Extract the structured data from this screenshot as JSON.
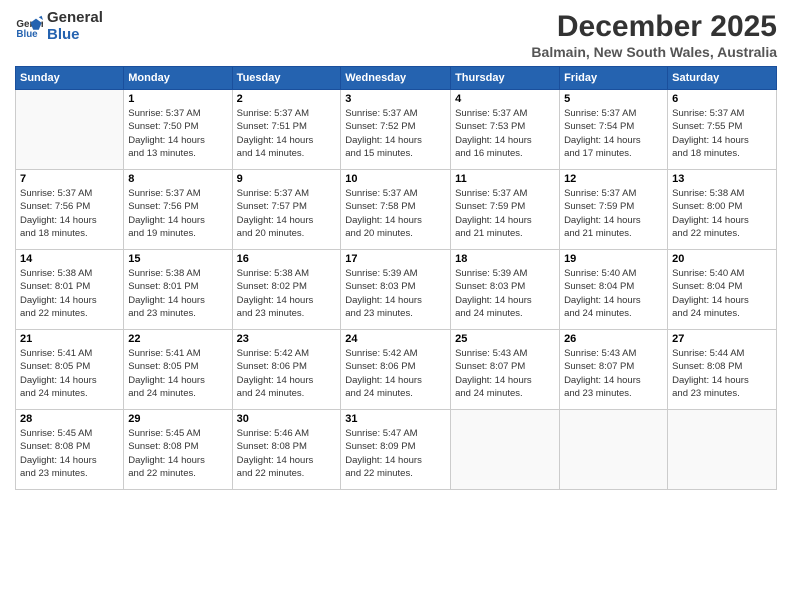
{
  "logo": {
    "line1": "General",
    "line2": "Blue"
  },
  "title": "December 2025",
  "subtitle": "Balmain, New South Wales, Australia",
  "days_header": [
    "Sunday",
    "Monday",
    "Tuesday",
    "Wednesday",
    "Thursday",
    "Friday",
    "Saturday"
  ],
  "weeks": [
    [
      {
        "num": "",
        "info": ""
      },
      {
        "num": "1",
        "info": "Sunrise: 5:37 AM\nSunset: 7:50 PM\nDaylight: 14 hours\nand 13 minutes."
      },
      {
        "num": "2",
        "info": "Sunrise: 5:37 AM\nSunset: 7:51 PM\nDaylight: 14 hours\nand 14 minutes."
      },
      {
        "num": "3",
        "info": "Sunrise: 5:37 AM\nSunset: 7:52 PM\nDaylight: 14 hours\nand 15 minutes."
      },
      {
        "num": "4",
        "info": "Sunrise: 5:37 AM\nSunset: 7:53 PM\nDaylight: 14 hours\nand 16 minutes."
      },
      {
        "num": "5",
        "info": "Sunrise: 5:37 AM\nSunset: 7:54 PM\nDaylight: 14 hours\nand 17 minutes."
      },
      {
        "num": "6",
        "info": "Sunrise: 5:37 AM\nSunset: 7:55 PM\nDaylight: 14 hours\nand 18 minutes."
      }
    ],
    [
      {
        "num": "7",
        "info": "Sunrise: 5:37 AM\nSunset: 7:56 PM\nDaylight: 14 hours\nand 18 minutes."
      },
      {
        "num": "8",
        "info": "Sunrise: 5:37 AM\nSunset: 7:56 PM\nDaylight: 14 hours\nand 19 minutes."
      },
      {
        "num": "9",
        "info": "Sunrise: 5:37 AM\nSunset: 7:57 PM\nDaylight: 14 hours\nand 20 minutes."
      },
      {
        "num": "10",
        "info": "Sunrise: 5:37 AM\nSunset: 7:58 PM\nDaylight: 14 hours\nand 20 minutes."
      },
      {
        "num": "11",
        "info": "Sunrise: 5:37 AM\nSunset: 7:59 PM\nDaylight: 14 hours\nand 21 minutes."
      },
      {
        "num": "12",
        "info": "Sunrise: 5:37 AM\nSunset: 7:59 PM\nDaylight: 14 hours\nand 21 minutes."
      },
      {
        "num": "13",
        "info": "Sunrise: 5:38 AM\nSunset: 8:00 PM\nDaylight: 14 hours\nand 22 minutes."
      }
    ],
    [
      {
        "num": "14",
        "info": "Sunrise: 5:38 AM\nSunset: 8:01 PM\nDaylight: 14 hours\nand 22 minutes."
      },
      {
        "num": "15",
        "info": "Sunrise: 5:38 AM\nSunset: 8:01 PM\nDaylight: 14 hours\nand 23 minutes."
      },
      {
        "num": "16",
        "info": "Sunrise: 5:38 AM\nSunset: 8:02 PM\nDaylight: 14 hours\nand 23 minutes."
      },
      {
        "num": "17",
        "info": "Sunrise: 5:39 AM\nSunset: 8:03 PM\nDaylight: 14 hours\nand 23 minutes."
      },
      {
        "num": "18",
        "info": "Sunrise: 5:39 AM\nSunset: 8:03 PM\nDaylight: 14 hours\nand 24 minutes."
      },
      {
        "num": "19",
        "info": "Sunrise: 5:40 AM\nSunset: 8:04 PM\nDaylight: 14 hours\nand 24 minutes."
      },
      {
        "num": "20",
        "info": "Sunrise: 5:40 AM\nSunset: 8:04 PM\nDaylight: 14 hours\nand 24 minutes."
      }
    ],
    [
      {
        "num": "21",
        "info": "Sunrise: 5:41 AM\nSunset: 8:05 PM\nDaylight: 14 hours\nand 24 minutes."
      },
      {
        "num": "22",
        "info": "Sunrise: 5:41 AM\nSunset: 8:05 PM\nDaylight: 14 hours\nand 24 minutes."
      },
      {
        "num": "23",
        "info": "Sunrise: 5:42 AM\nSunset: 8:06 PM\nDaylight: 14 hours\nand 24 minutes."
      },
      {
        "num": "24",
        "info": "Sunrise: 5:42 AM\nSunset: 8:06 PM\nDaylight: 14 hours\nand 24 minutes."
      },
      {
        "num": "25",
        "info": "Sunrise: 5:43 AM\nSunset: 8:07 PM\nDaylight: 14 hours\nand 24 minutes."
      },
      {
        "num": "26",
        "info": "Sunrise: 5:43 AM\nSunset: 8:07 PM\nDaylight: 14 hours\nand 23 minutes."
      },
      {
        "num": "27",
        "info": "Sunrise: 5:44 AM\nSunset: 8:08 PM\nDaylight: 14 hours\nand 23 minutes."
      }
    ],
    [
      {
        "num": "28",
        "info": "Sunrise: 5:45 AM\nSunset: 8:08 PM\nDaylight: 14 hours\nand 23 minutes."
      },
      {
        "num": "29",
        "info": "Sunrise: 5:45 AM\nSunset: 8:08 PM\nDaylight: 14 hours\nand 22 minutes."
      },
      {
        "num": "30",
        "info": "Sunrise: 5:46 AM\nSunset: 8:08 PM\nDaylight: 14 hours\nand 22 minutes."
      },
      {
        "num": "31",
        "info": "Sunrise: 5:47 AM\nSunset: 8:09 PM\nDaylight: 14 hours\nand 22 minutes."
      },
      {
        "num": "",
        "info": ""
      },
      {
        "num": "",
        "info": ""
      },
      {
        "num": "",
        "info": ""
      }
    ]
  ]
}
